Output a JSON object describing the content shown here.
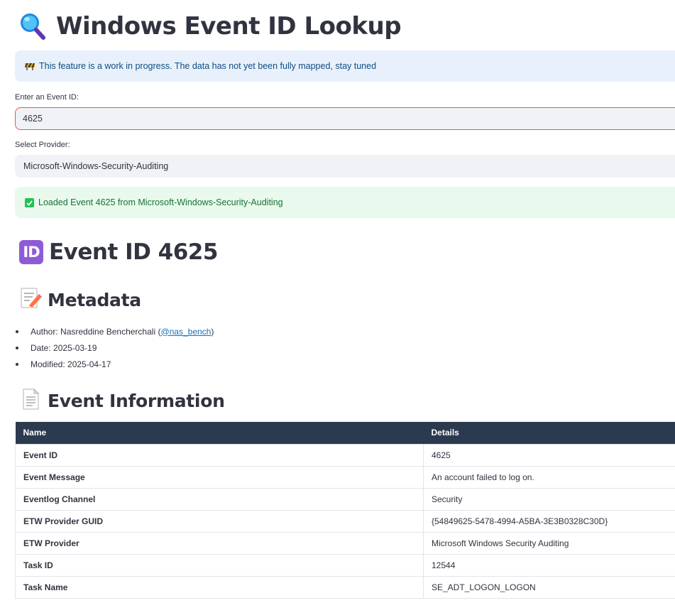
{
  "header": {
    "title": "Windows Event ID Lookup",
    "icon": "magnifying-glass-icon"
  },
  "info_banner": {
    "icon": "construction-icon",
    "text": "This feature is a work in progress. The data has not yet been fully mapped, stay tuned"
  },
  "event_input": {
    "label": "Enter an Event ID:",
    "value": "4625"
  },
  "provider_select": {
    "label": "Select Provider:",
    "value": "Microsoft-Windows-Security-Auditing"
  },
  "success_banner": {
    "icon": "check-mark-icon",
    "text": "Loaded Event 4625 from Microsoft-Windows-Security-Auditing"
  },
  "event_heading": {
    "badge": "ID",
    "title": "Event ID 4625"
  },
  "metadata": {
    "heading": "Metadata",
    "icon": "memo-icon",
    "author_prefix": "Author: Nasreddine Bencherchali (",
    "author_handle": "@nas_bench",
    "author_suffix": ")",
    "date": "Date: 2025-03-19",
    "modified": "Modified: 2025-04-17"
  },
  "event_info": {
    "heading": "Event Information",
    "icon": "page-icon",
    "columns": [
      "Name",
      "Details"
    ],
    "rows": [
      {
        "name": "Event ID",
        "details": "4625"
      },
      {
        "name": "Event Message",
        "details": "An account failed to log on."
      },
      {
        "name": "Eventlog Channel",
        "details": "Security"
      },
      {
        "name": "ETW Provider GUID",
        "details": "{54849625-5478-4994-A5BA-3E3B0328C30D}"
      },
      {
        "name": "ETW Provider",
        "details": "Microsoft Windows Security Auditing"
      },
      {
        "name": "Task ID",
        "details": "12544"
      },
      {
        "name": "Task Name",
        "details": "SE_ADT_LOGON_LOGON"
      }
    ]
  },
  "colors": {
    "accent": "#ff4b4b",
    "info_bg": "#e8f1fb",
    "success_bg": "#e9f9ee",
    "table_header": "#2c3a4f",
    "badge": "#8e5bd8"
  }
}
